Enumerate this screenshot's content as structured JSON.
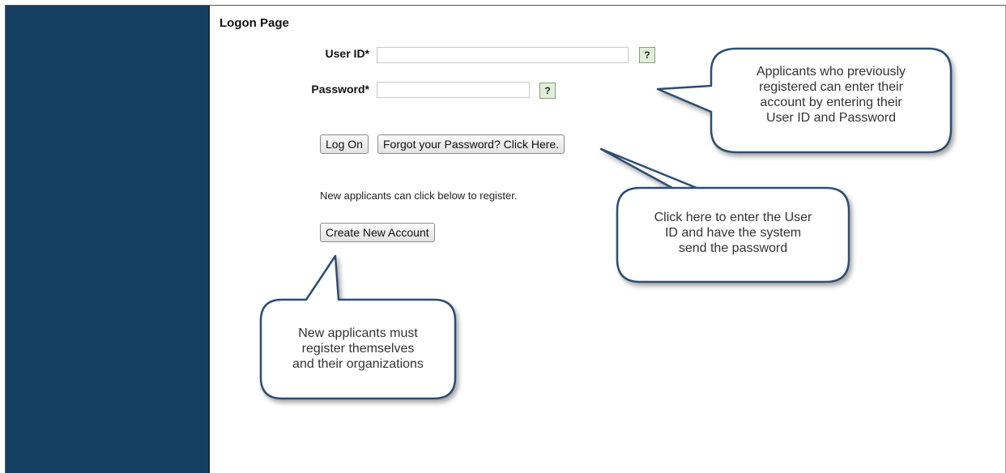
{
  "page": {
    "title": "Logon Page"
  },
  "form": {
    "user_id_label": "User ID*",
    "user_id_value": "",
    "password_label": "Password*",
    "password_value": "",
    "help_label": "?"
  },
  "buttons": {
    "log_on": "Log On",
    "forgot_password": "Forgot your Password? Click Here.",
    "create_account": "Create New Account"
  },
  "register_info": "New applicants can click below to register.",
  "callouts": {
    "login": [
      "Applicants who previously",
      "registered can enter their",
      "account by entering their",
      "User ID and Password"
    ],
    "forgot": [
      "Click here to enter the User",
      "ID and have the system",
      "send the password"
    ],
    "register": [
      "New applicants must",
      "register themselves",
      "and their organizations"
    ]
  },
  "colors": {
    "sidebar": "#143f63",
    "help_button_bg": "#dff0d8",
    "callout_border": "#2f4e73"
  }
}
